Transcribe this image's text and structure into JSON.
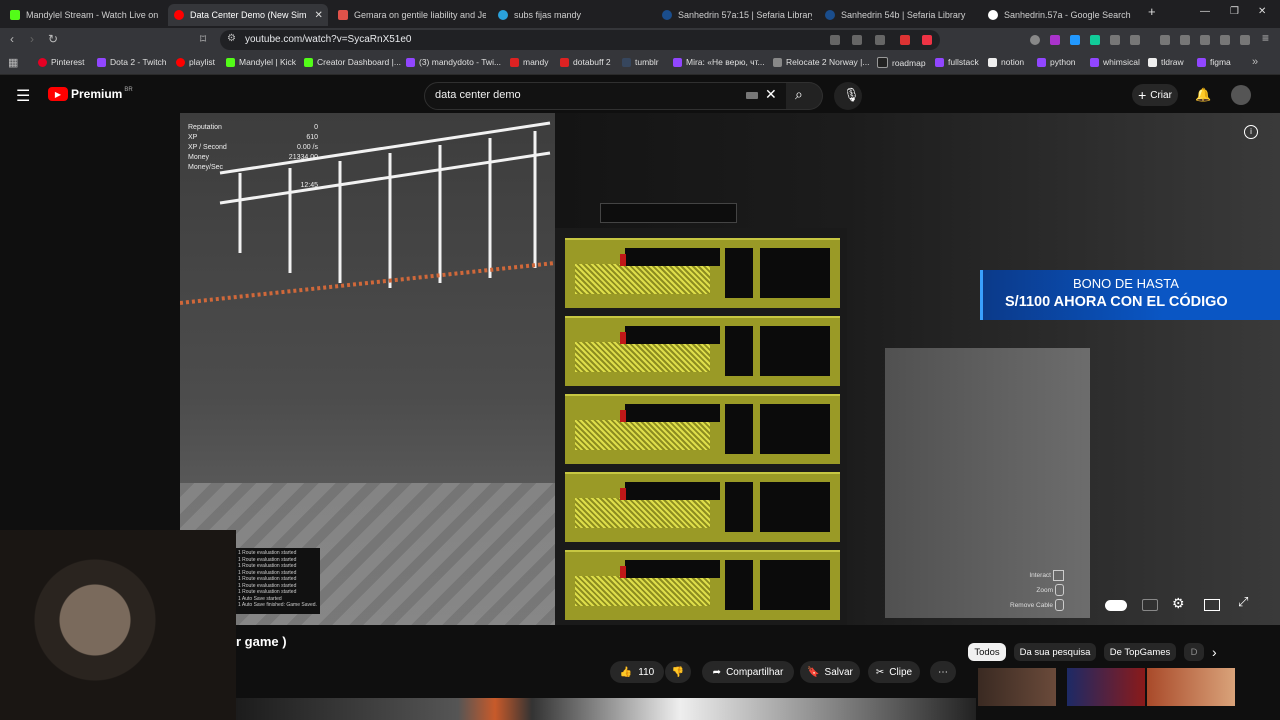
{
  "tabs": [
    {
      "label": "Mandylel Stream - Watch Live on Ki",
      "color": "#53fc18"
    },
    {
      "label": "Data Center Demo (New Sim",
      "color": "#ff0000",
      "active": true
    },
    {
      "label": "Gemara on gentile liability and Jewi",
      "color": "#e0524a"
    },
    {
      "label": "subs fijas mandy",
      "color": "#2aa1db"
    },
    {
      "label": "Sanhedrin 57a:15 | Sefaria Library",
      "color": "#1a4d8c"
    },
    {
      "label": "Sanhedrin 54b | Sefaria Library",
      "color": "#1a4d8c"
    },
    {
      "label": "Sanhedrin.57a - Google Search",
      "color": "#ffffff"
    }
  ],
  "address": {
    "url": "youtube.com/watch?v=SycaRnX51e0"
  },
  "bookmarks": [
    {
      "label": "Pinterest",
      "color": "#e60023"
    },
    {
      "label": "Dota 2 - Twitch",
      "color": "#9146ff"
    },
    {
      "label": "playlist",
      "color": "#ff0000"
    },
    {
      "label": "Mandylel | Kick",
      "color": "#53fc18"
    },
    {
      "label": "Creator Dashboard |...",
      "color": "#53fc18"
    },
    {
      "label": "(3) mandydoto - Twi...",
      "color": "#9146ff"
    },
    {
      "label": "mandy",
      "color": "#d22"
    },
    {
      "label": "dotabuff 2",
      "color": "#d22"
    },
    {
      "label": "tumblr",
      "color": "#36465d"
    },
    {
      "label": "Mira: «Не верю, чт...",
      "color": "#9146ff"
    },
    {
      "label": "Relocate 2 Norway |...",
      "color": "#888"
    },
    {
      "label": "roadmap",
      "color": "#222"
    },
    {
      "label": "fullstack",
      "color": "#9146ff"
    },
    {
      "label": "notion",
      "color": "#eee"
    },
    {
      "label": "python",
      "color": "#9146ff"
    },
    {
      "label": "whimsical",
      "color": "#9146ff"
    },
    {
      "label": "tldraw",
      "color": "#eee"
    },
    {
      "label": "figma",
      "color": "#9146ff"
    }
  ],
  "youtube": {
    "logo_text": "Premium",
    "region": "BR",
    "search_value": "data center demo",
    "create_label": "Criar"
  },
  "video": {
    "hud": {
      "reputation_label": "Reputation",
      "reputation_value": "0",
      "xp_label": "XP",
      "xp_value": "610",
      "xp_second_label": "XP / Second",
      "xp_second_value": "0.00 /s",
      "money_label": "Money",
      "money_value": "21334.00",
      "money_second_label": "Money/Sec",
      "time": "12:45"
    },
    "promo_line1": "BONO DE HASTA",
    "promo_line2": "S/1100 AHORA CON EL CÓDIGO",
    "hint_interact": "Interact",
    "hint_zoom": "Zoom",
    "hint_remove": "Remove Cable",
    "log_lines": [
      "1 Route evaluation started",
      "1 Route evaluation started",
      "1 Route evaluation started",
      "1 Route evaluation started",
      "1 Route evaluation started",
      "1 Route evaluation started",
      "1 Route evaluation started",
      "1 Auto Save started",
      "1 Auto Save finished: Game Saved."
    ]
  },
  "below_video": {
    "title_fragment": "r game )",
    "likes": "110",
    "share_label": "Compartilhar",
    "save_label": "Salvar",
    "clip_label": "Clipe",
    "chips": [
      "Todos",
      "Da sua pesquisa",
      "De TopGames",
      "D"
    ]
  }
}
